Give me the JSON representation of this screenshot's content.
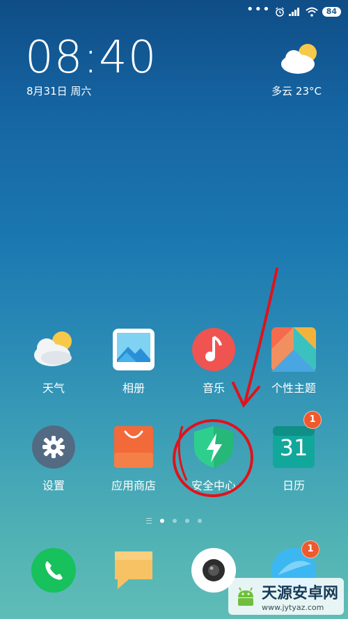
{
  "status_bar": {
    "battery": "84"
  },
  "lockscreen": {
    "time": "08:40",
    "date": "8月31日 周六",
    "weather": "多云  23°C"
  },
  "apps_row1": [
    {
      "label": "天气",
      "icon": "weather-icon"
    },
    {
      "label": "相册",
      "icon": "gallery-icon"
    },
    {
      "label": "音乐",
      "icon": "music-icon"
    },
    {
      "label": "个性主题",
      "icon": "themes-icon"
    }
  ],
  "apps_row2": [
    {
      "label": "设置",
      "icon": "settings-icon"
    },
    {
      "label": "应用商店",
      "icon": "app-store-icon"
    },
    {
      "label": "安全中心",
      "icon": "security-center-icon"
    },
    {
      "label": "日历",
      "icon": "calendar-icon",
      "date": "31",
      "badge": "1"
    }
  ],
  "dock": [
    {
      "icon": "phone-icon"
    },
    {
      "icon": "messages-icon"
    },
    {
      "icon": "camera-icon"
    },
    {
      "icon": "browser-icon",
      "badge": "1"
    }
  ],
  "watermark": {
    "title": "天源安卓网",
    "url": "www.jytyaz.com"
  },
  "colors": {
    "annotation": "#e0121b",
    "badge": "#f0592d",
    "security": "#2ecf8d"
  }
}
